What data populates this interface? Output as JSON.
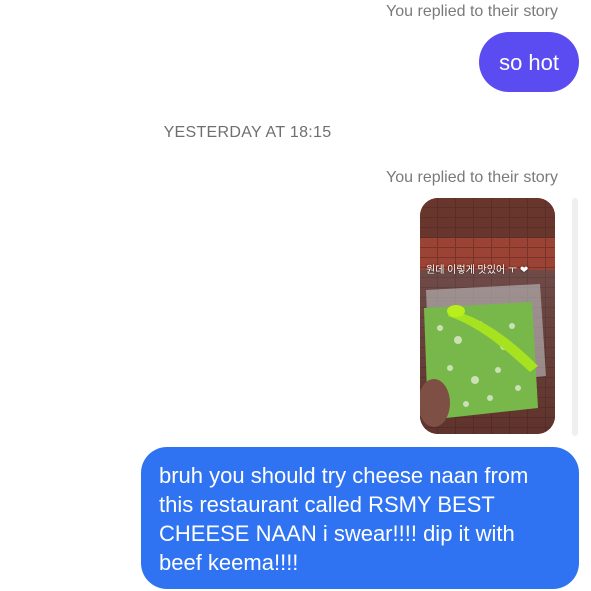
{
  "thread": {
    "reply_note_1": "You replied to their story",
    "message_1": "so hot",
    "timestamp": "YESTERDAY AT 18:15",
    "reply_note_2": "You replied to their story",
    "story_caption": "원데 이렇게 맛있어 ㅜ ❤",
    "message_2": "bruh you should try cheese naan from this restaurant called RSMY BEST CHEESE NAAN i swear!!!! dip it with beef keema!!!!"
  },
  "colors": {
    "bubble_purple": "#5a4cf0",
    "bubble_blue": "#2f73f3",
    "meta_text": "#7a7a7a"
  }
}
